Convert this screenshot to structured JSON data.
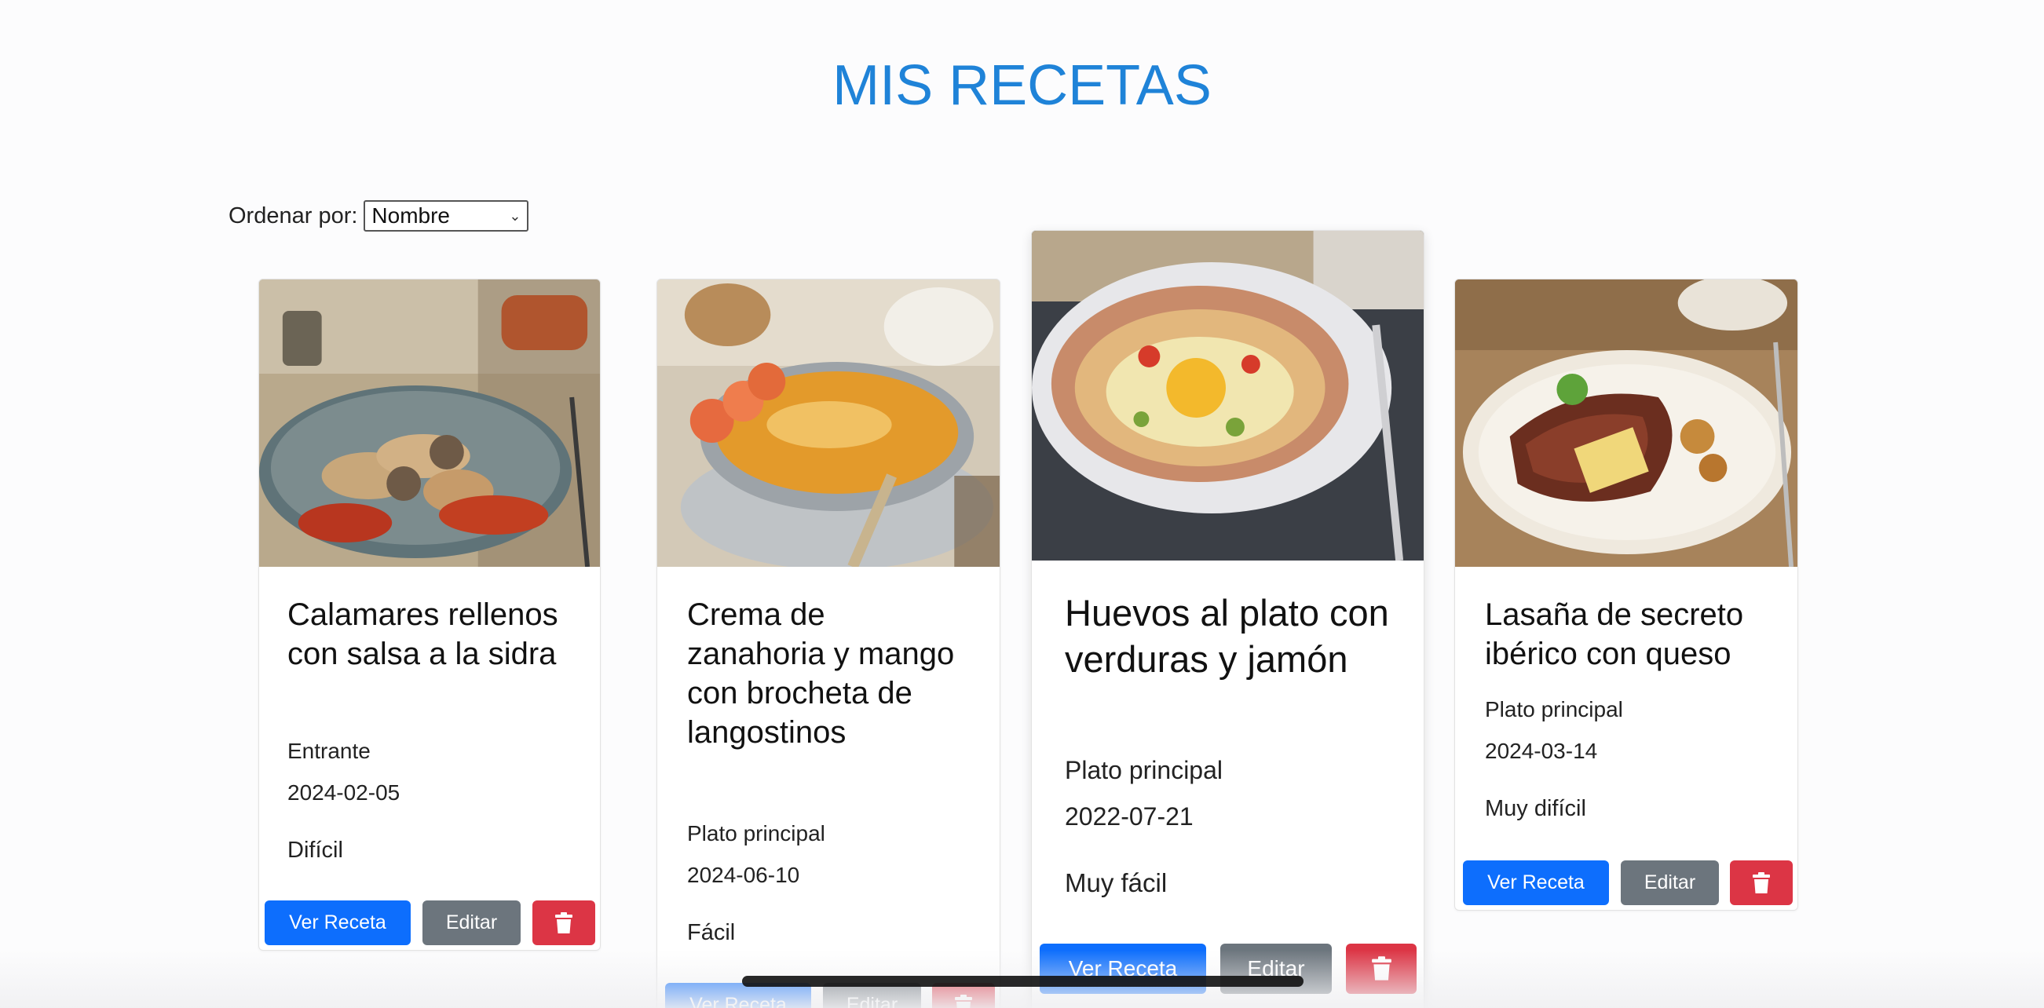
{
  "page": {
    "title": "MIS RECETAS",
    "accent_color": "#1f83d8"
  },
  "sort": {
    "label": "Ordenar por:",
    "selected": "Nombre"
  },
  "buttons": {
    "view": "Ver Receta",
    "edit": "Editar",
    "delete_icon": "trash-icon"
  },
  "recipes": [
    {
      "name": "Calamares rellenos con salsa a la sidra",
      "category": "Entrante",
      "date": "2024-02-05",
      "difficulty": "Difícil"
    },
    {
      "name": "Crema de zanahoria y mango con brocheta de langostinos",
      "category": "Plato principal",
      "date": "2024-06-10",
      "difficulty": "Fácil"
    },
    {
      "name": "Huevos al plato con verduras y jamón",
      "category": "Plato principal",
      "date": "2022-07-21",
      "difficulty": "Muy fácil"
    },
    {
      "name": "Lasaña de secreto ibérico con queso",
      "category": "Plato principal",
      "date": "2024-03-14",
      "difficulty": "Muy difícil"
    }
  ]
}
